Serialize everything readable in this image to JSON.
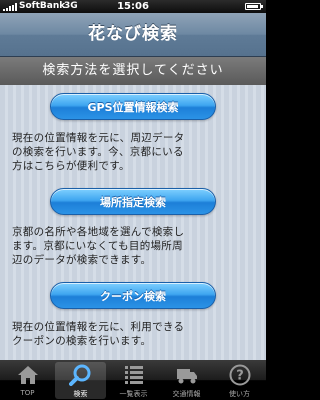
{
  "status_bar": {
    "carrier": "SoftBank",
    "network": "3G",
    "time": "15:06"
  },
  "nav_bar": {
    "title": "花なび検索"
  },
  "section_header": {
    "label": "検索方法を選択してください"
  },
  "modes": [
    {
      "button_label": "GPS位置情報検索",
      "desc_lines": [
        "現在の位置情報を元に、周辺データ",
        "の検索を行います。今、京都にいる",
        "方はこちらが便利です。"
      ]
    },
    {
      "button_label": "場所指定検索",
      "desc_lines": [
        "京都の名所や各地域を選んで検索し",
        "ます。京都にいなくても目的場所周",
        "辺のデータが検索できます。"
      ]
    },
    {
      "button_label": "クーポン検索",
      "desc_lines": [
        "現在の位置情報を元に、利用できる",
        "クーポンの検索を行います。"
      ]
    }
  ],
  "tab_bar": {
    "active": "search",
    "tabs": [
      {
        "id": "top",
        "label": "TOP",
        "icon": "home-icon"
      },
      {
        "id": "search",
        "label": "検索",
        "icon": "magnifier-icon"
      },
      {
        "id": "list",
        "label": "一覧表示",
        "icon": "list-icon"
      },
      {
        "id": "transit",
        "label": "交通情報",
        "icon": "truck-icon"
      },
      {
        "id": "help",
        "label": "使い方",
        "icon": "question-icon"
      }
    ]
  },
  "colors": {
    "nav_bar": "#6d88a2",
    "button": "#2b93e6",
    "content_bg": "#c9d2de"
  }
}
